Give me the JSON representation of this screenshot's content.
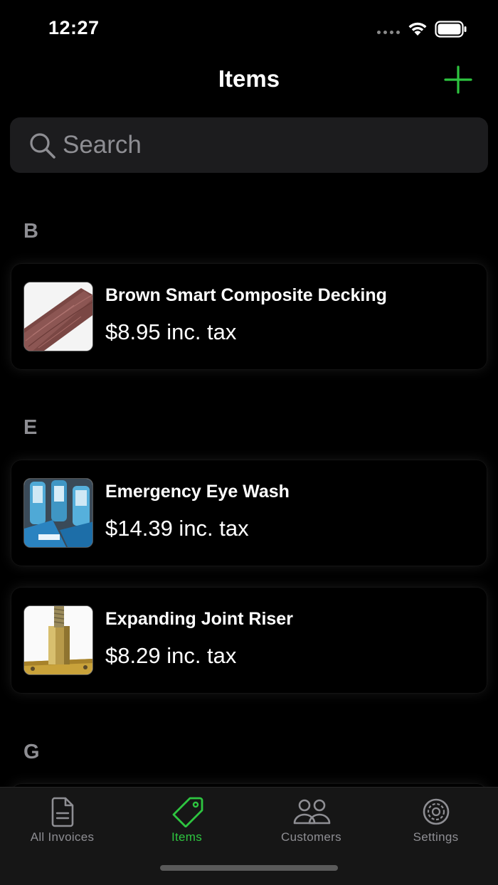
{
  "status_bar": {
    "time": "12:27"
  },
  "nav": {
    "title": "Items",
    "add_icon": "plus-icon"
  },
  "search": {
    "placeholder": "Search",
    "value": ""
  },
  "colors": {
    "accent": "#2ec540",
    "background": "#000000",
    "card": "#000000",
    "secondary_text": "#8e8e93",
    "search_bg": "#1c1c1e"
  },
  "sections": [
    {
      "letter": "B",
      "items": [
        {
          "name": "Brown Smart Composite Decking",
          "price": "$8.95 inc. tax",
          "thumb": "decking-image"
        }
      ]
    },
    {
      "letter": "E",
      "items": [
        {
          "name": "Emergency Eye Wash",
          "price": "$14.39 inc. tax",
          "thumb": "eye-wash-image"
        },
        {
          "name": "Expanding Joint Riser",
          "price": "$8.29 inc. tax",
          "thumb": "joint-riser-image"
        }
      ]
    },
    {
      "letter": "G",
      "items": []
    }
  ],
  "tabs": [
    {
      "label": "All Invoices",
      "icon": "document-icon",
      "active": false
    },
    {
      "label": "Items",
      "icon": "tag-icon",
      "active": true
    },
    {
      "label": "Customers",
      "icon": "people-icon",
      "active": false
    },
    {
      "label": "Settings",
      "icon": "gear-icon",
      "active": false
    }
  ]
}
